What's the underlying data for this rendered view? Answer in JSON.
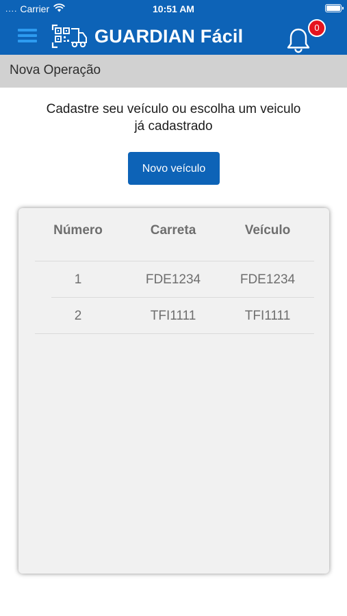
{
  "status_bar": {
    "signal": "....",
    "carrier": "Carrier",
    "time": "10:51 AM",
    "wifi_icon": "wifi-icon",
    "battery_icon": "battery-icon"
  },
  "header": {
    "menu_icon": "hamburger-menu-icon",
    "logo_icon": "qr-truck-logo-icon",
    "app_name": "GUARDIAN Fácil",
    "bell_icon": "bell-icon",
    "notification_count": "0",
    "colors": {
      "background": "#0d63b7",
      "menu_icon": "#2d9bf0",
      "badge": "#e5141e"
    }
  },
  "section": {
    "title": "Nova Operação"
  },
  "main": {
    "instruction_line1": "Cadastre seu veículo ou escolha um veiculo",
    "instruction_line2": "já cadastrado",
    "new_vehicle_label": "Novo veículo"
  },
  "table": {
    "headers": [
      "Número",
      "Carreta",
      "Veículo"
    ],
    "rows": [
      [
        "1",
        "FDE1234",
        "FDE1234"
      ],
      [
        "2",
        "TFI1111",
        "TFI1111"
      ]
    ]
  }
}
